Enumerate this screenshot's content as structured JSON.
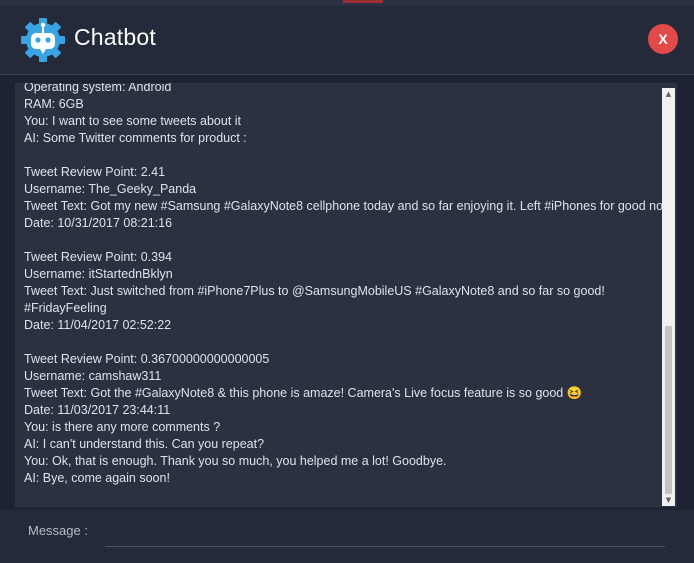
{
  "app": {
    "title": "Chatbot",
    "close_label": "X",
    "logo_icon": "robot-gear-icon"
  },
  "chat": {
    "lines": [
      "Operating system: Android",
      "RAM: 6GB",
      "You: I want to see some tweets about it",
      "AI: Some Twitter comments for product :",
      "",
      "Tweet Review Point: 2.41",
      "Username: The_Geeky_Panda",
      "Tweet Text: Got my new #Samsung #GalaxyNote8 cellphone today and so far enjoying it. Left #iPhones for good now.",
      "Date:  10/31/2017 08:21:16",
      "",
      "Tweet Review Point: 0.394",
      "Username: itStartednBklyn",
      "Tweet Text: Just switched from #iPhone7Plus to @SamsungMobileUS #GalaxyNote8 and so far so good!",
      "#FridayFeeling",
      "Date:  11/04/2017 02:52:22",
      "",
      "Tweet Review Point: 0.36700000000000005",
      "Username: camshaw311",
      "Tweet Text: Got the #GalaxyNote8 & this phone is amaze! Camera's Live focus feature is so good 😆",
      "Date:  11/03/2017 23:44:11",
      "You: is there any more comments ?",
      "AI: I can't understand this. Can you repeat?",
      "You: Ok, that is enough. Thank you so much, you helped me a lot! Goodbye.",
      "AI: Bye, come again soon!"
    ],
    "scroll_position": 0.97
  },
  "footer": {
    "message_label": "Message :",
    "message_value": ""
  },
  "colors": {
    "background": "#1e2233",
    "panel": "#2c3142",
    "accent": "#3aa3e3",
    "close": "#e24a4a"
  }
}
